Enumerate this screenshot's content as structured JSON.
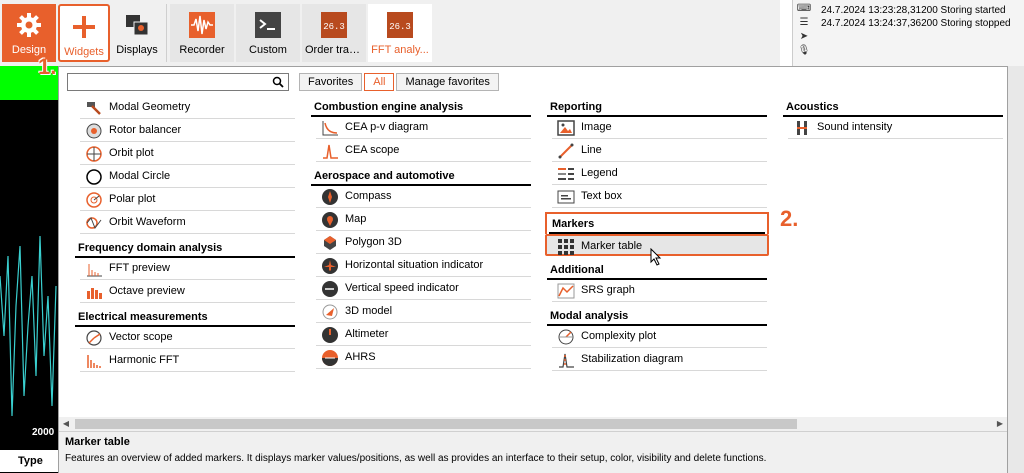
{
  "toolbar": {
    "design": "Design",
    "widgets": "Widgets",
    "displays": "Displays",
    "recorder": "Recorder",
    "custom": "Custom",
    "order": "Order trac...",
    "order_icon_text": "26.3",
    "fft": "FFT analy...",
    "fft_icon_text": "26.3",
    "accent": "#e8602c"
  },
  "status": {
    "log": [
      "24.7.2024 13:23:28,31200 Storing started",
      "24.7.2024 13:24:37,36200 Storing stopped"
    ]
  },
  "left": {
    "axis_value": "2000",
    "type_label": "Type"
  },
  "popup": {
    "search_placeholder": "",
    "tabs": [
      "Favorites",
      "All",
      "Manage favorites"
    ],
    "active_tab": "All",
    "columns": [
      {
        "groups": [
          {
            "title": "",
            "items": [
              "Modal Geometry",
              "Rotor balancer",
              "Orbit plot",
              "Modal Circle",
              "Polar plot",
              "Orbit Waveform"
            ]
          },
          {
            "title": "Frequency domain analysis",
            "items": [
              "FFT preview",
              "Octave preview"
            ]
          },
          {
            "title": "Electrical measurements",
            "items": [
              "Vector scope",
              "Harmonic FFT"
            ]
          }
        ]
      },
      {
        "groups": [
          {
            "title": "Combustion engine analysis",
            "items": [
              "CEA p-v diagram",
              "CEA scope"
            ]
          },
          {
            "title": "Aerospace and automotive",
            "items": [
              "Compass",
              "Map",
              "Polygon 3D",
              "Horizontal situation indicator",
              "Vertical speed indicator",
              "3D model",
              "Altimeter",
              "AHRS"
            ]
          }
        ]
      },
      {
        "groups": [
          {
            "title": "Reporting",
            "items": [
              "Image",
              "Line",
              "Legend",
              "Text box"
            ]
          },
          {
            "title": "Markers",
            "items": [
              "Marker table"
            ]
          },
          {
            "title": "Additional",
            "items": [
              "SRS graph"
            ]
          },
          {
            "title": "Modal analysis",
            "items": [
              "Complexity plot",
              "Stabilization diagram"
            ]
          }
        ]
      },
      {
        "groups": [
          {
            "title": "Acoustics",
            "items": [
              "Sound intensity"
            ]
          }
        ]
      }
    ]
  },
  "description": {
    "title": "Marker table",
    "text": "Features an overview of added markers. It displays marker values/positions, as well as provides an interface to their setup, color, visibility and delete functions."
  },
  "annotations": {
    "step1": "1.",
    "step2": "2."
  }
}
